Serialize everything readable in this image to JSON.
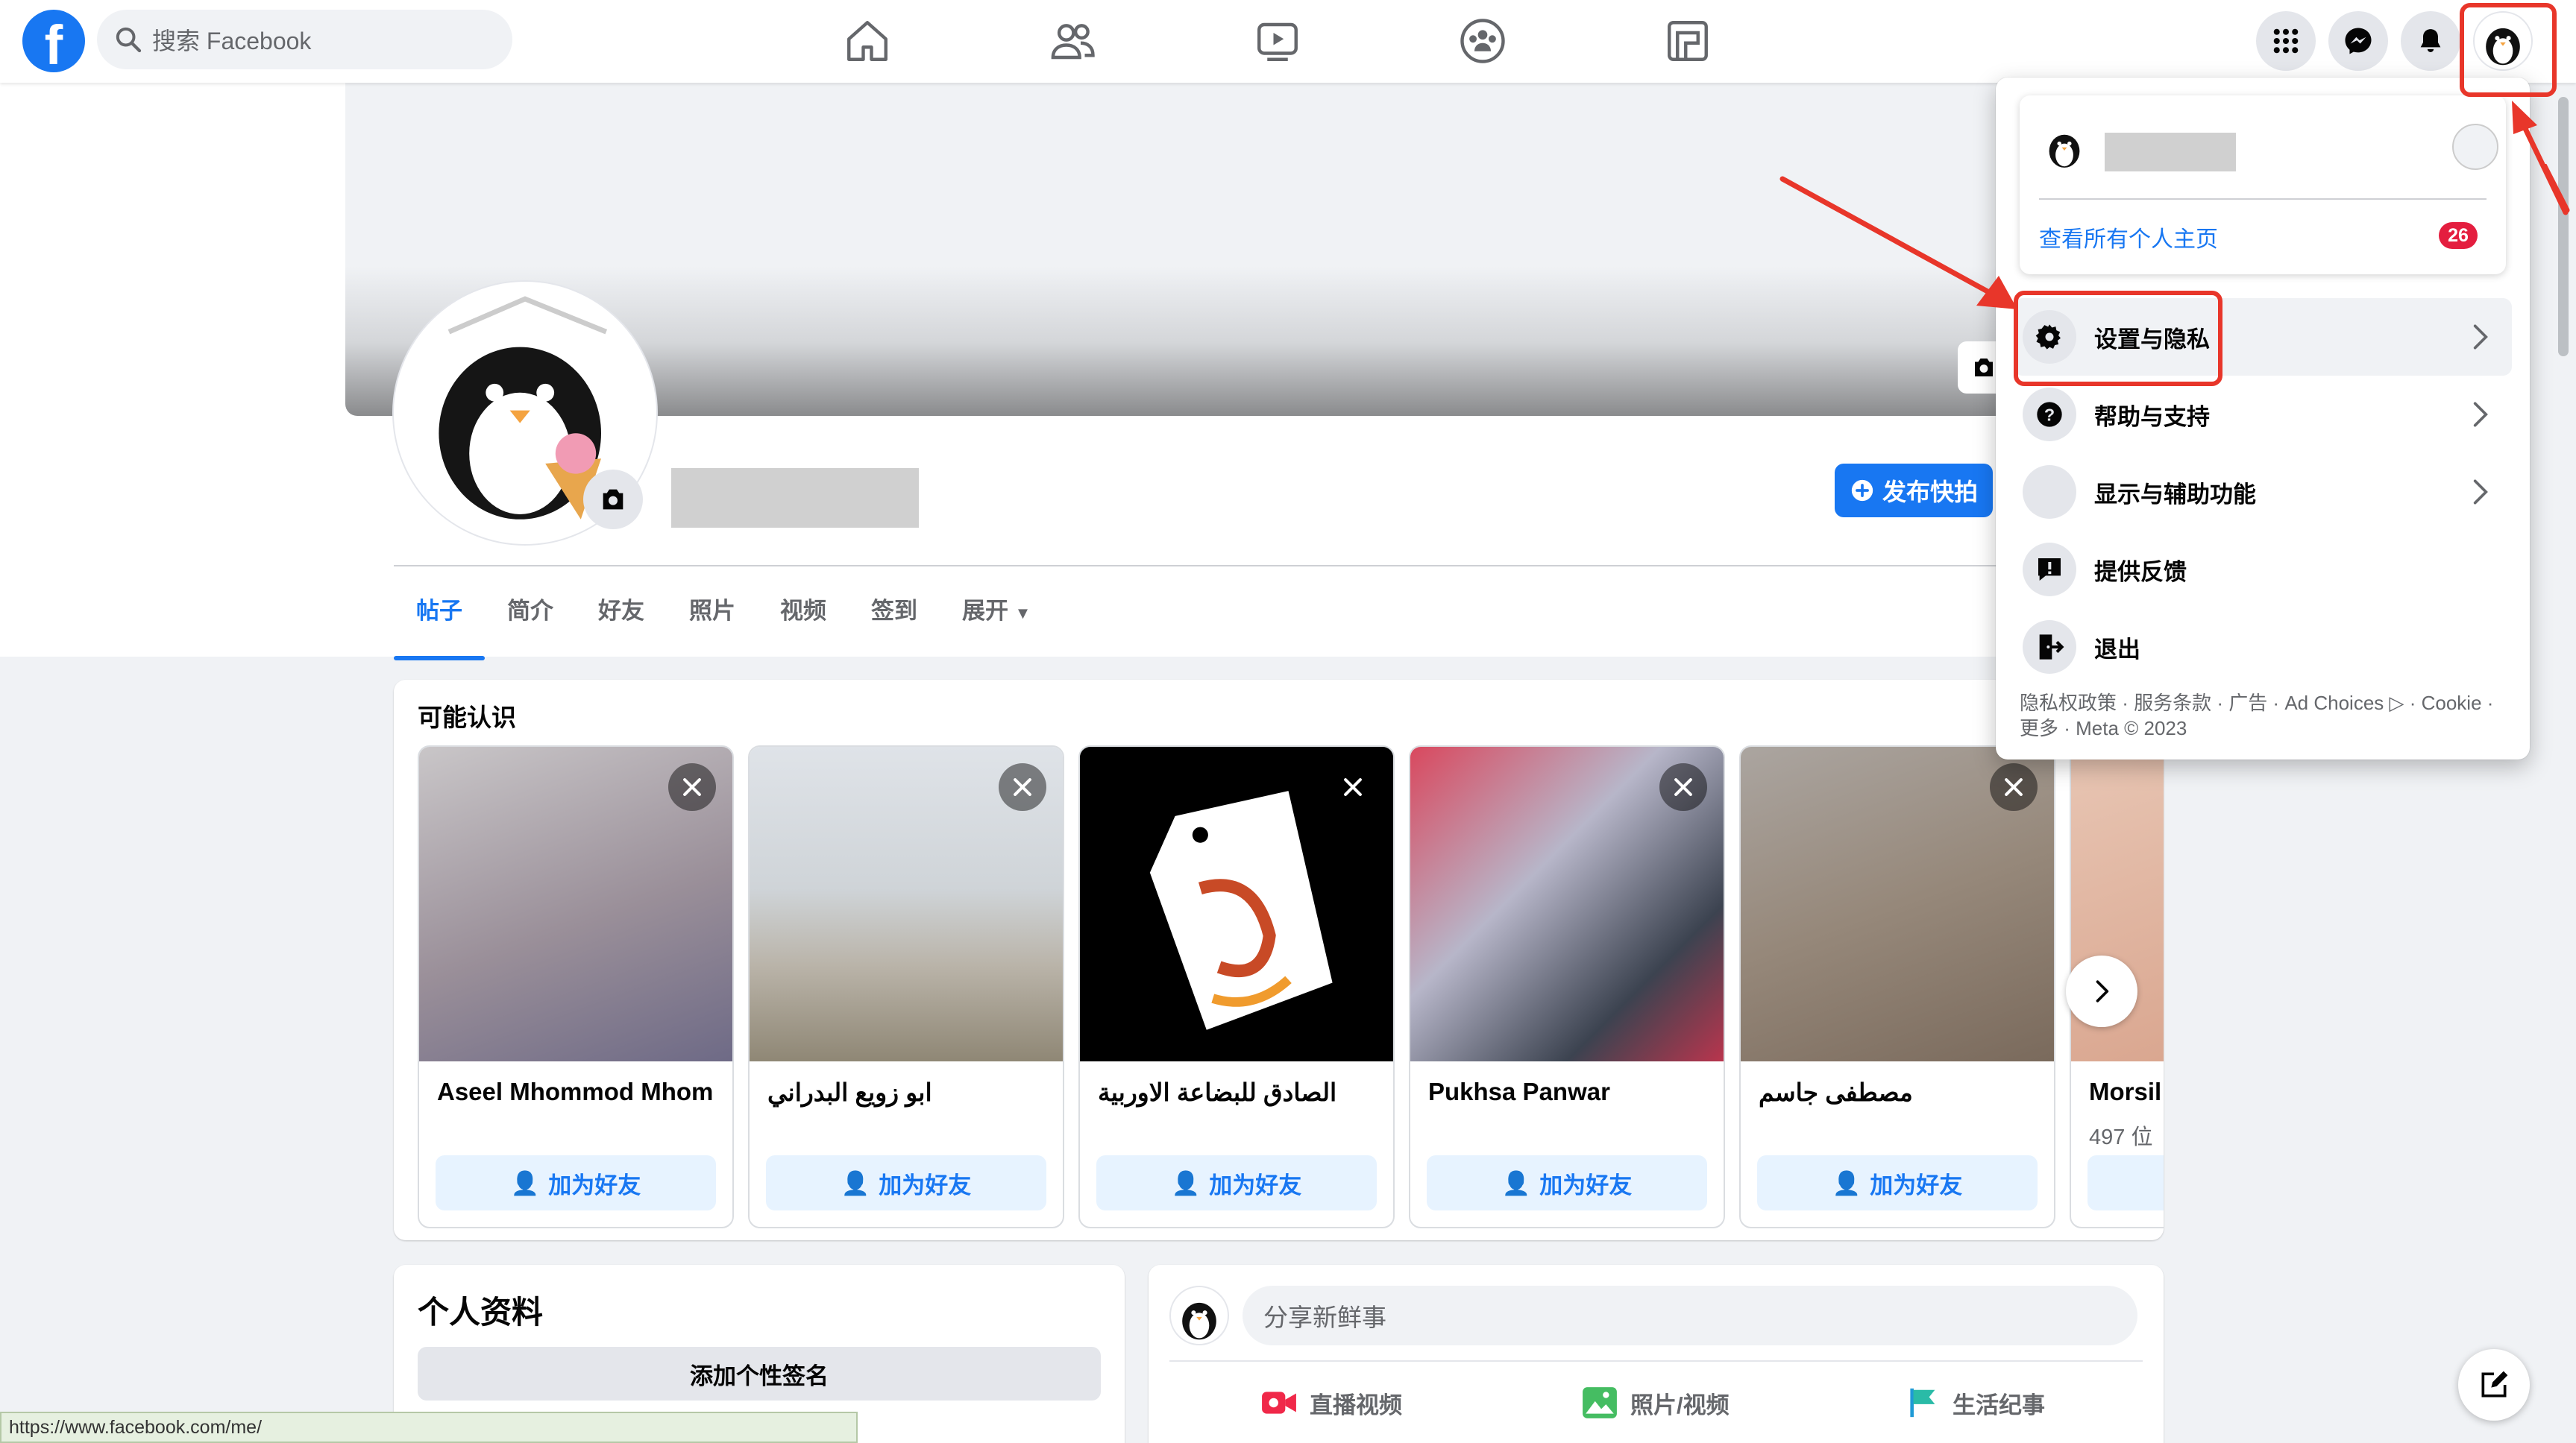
{
  "topbar": {
    "logo": "f",
    "search_placeholder": "搜索 Facebook",
    "nav_icons": [
      "home-icon",
      "friends-icon",
      "watch-icon",
      "groups-icon",
      "gaming-icon"
    ],
    "right_icons": [
      "menu-grid-icon",
      "messenger-icon",
      "notifications-icon",
      "account-avatar"
    ]
  },
  "profile": {
    "post_story_label": "发布快拍",
    "tabs": [
      "帖子",
      "简介",
      "好友",
      "照片",
      "视频",
      "签到",
      "展开"
    ]
  },
  "pymk": {
    "title": "可能认识",
    "add_friend_label": "加为好友",
    "cards": [
      {
        "name": "Aseel Mhommod Mhom",
        "sub": ""
      },
      {
        "name": "ابو زويع البدراني",
        "sub": ""
      },
      {
        "name": "الصادق للبضاعة الاوربية",
        "sub": ""
      },
      {
        "name": "Pukhsa Panwar",
        "sub": ""
      },
      {
        "name": "مصطفى جاسم",
        "sub": ""
      },
      {
        "name": "Morsil",
        "sub": "497 位"
      }
    ]
  },
  "intro": {
    "title": "个人资料",
    "add_bio_label": "添加个性签名"
  },
  "composer": {
    "placeholder": "分享新鲜事",
    "actions": [
      "直播视频",
      "照片/视频",
      "生活纪事"
    ]
  },
  "dropdown": {
    "see_all_profiles": "查看所有个人主页",
    "badge_count": "26",
    "items": [
      {
        "label": "设置与隐私",
        "icon": "gear-icon",
        "has_chevron": true
      },
      {
        "label": "帮助与支持",
        "icon": "help-icon",
        "has_chevron": true
      },
      {
        "label": "显示与辅助功能",
        "icon": "moon-icon",
        "has_chevron": true
      },
      {
        "label": "提供反馈",
        "icon": "feedback-icon",
        "has_chevron": false
      },
      {
        "label": "退出",
        "icon": "logout-icon",
        "has_chevron": false
      }
    ],
    "footer": "隐私权政策 · 服务条款 · 广告 · Ad Choices ▷ · Cookie · 更多 · Meta © 2023"
  },
  "status_url": "https://www.facebook.com/me/",
  "colors": {
    "accent": "#1877f2",
    "annotation": "#e8362a",
    "badge": "#e41e3f"
  }
}
